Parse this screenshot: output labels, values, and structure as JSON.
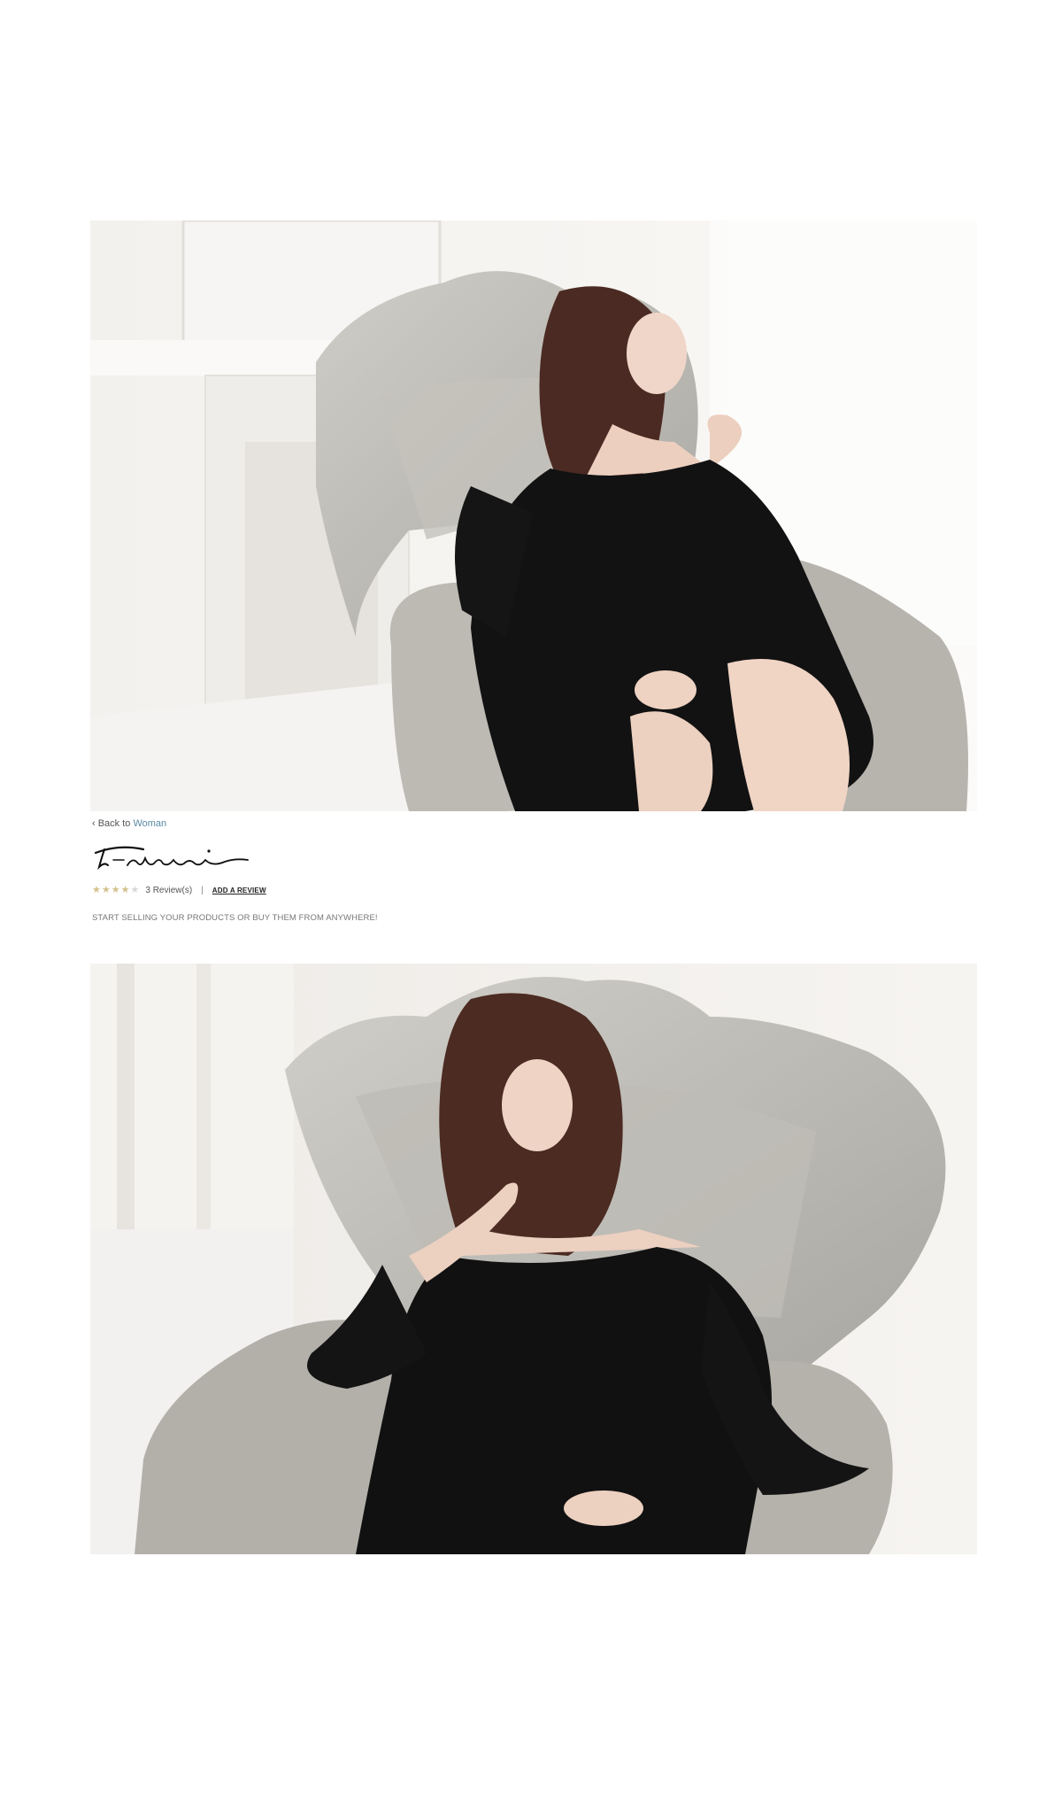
{
  "colors": {
    "link": "#5a8aa3",
    "star_filled": "#d3c08c",
    "star_empty": "#d8d8d8",
    "text_muted": "#777777"
  },
  "breadcrumb": {
    "prefix": "‹ Back to ",
    "link_label": "Woman"
  },
  "brand": {
    "logo_text": "T-nani"
  },
  "rating": {
    "stars_filled": 4,
    "stars_total": 5,
    "reviews_label": "3 Review(s)",
    "separator": "|",
    "add_review_label": "ADD A REVIEW"
  },
  "tagline": "START SELLING YOUR PRODUCTS OR BUY THEM FROM ANYWHERE!",
  "gallery": {
    "images": [
      {
        "description_icon": "product-photo"
      },
      {
        "description_icon": "product-photo"
      }
    ]
  }
}
